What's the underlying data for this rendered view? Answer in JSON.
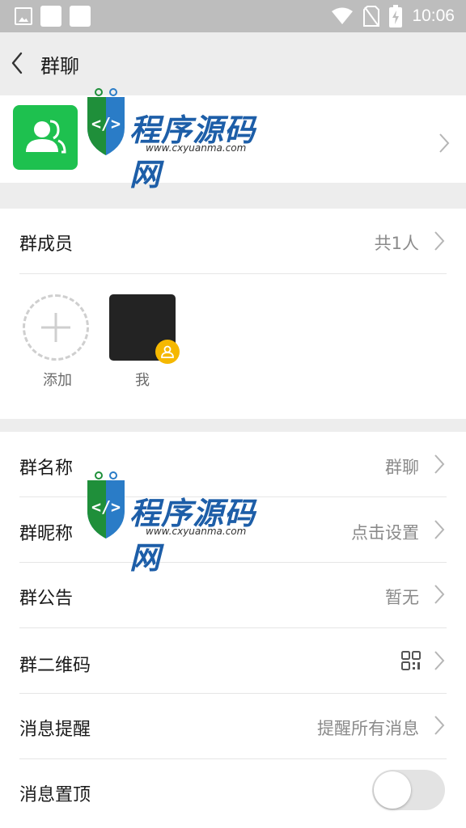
{
  "status_bar": {
    "time": "10:06"
  },
  "header": {
    "title": "群聊"
  },
  "members": {
    "label": "群成员",
    "count": "共1人",
    "add_label": "添加",
    "me_label": "我"
  },
  "settings": {
    "group_name": {
      "label": "群名称",
      "value": "群聊"
    },
    "nickname": {
      "label": "群昵称",
      "value": "点击设置"
    },
    "notice": {
      "label": "群公告",
      "value": "暂无"
    },
    "qrcode": {
      "label": "群二维码"
    },
    "reminder": {
      "label": "消息提醒",
      "value": "提醒所有消息"
    },
    "pin": {
      "label": "消息置顶",
      "enabled": false
    }
  },
  "watermark": {
    "text": "程序源码网",
    "url": "www.cxyuanma.com"
  },
  "colors": {
    "accent_green": "#1ec14f",
    "owner_badge": "#f5b800",
    "watermark_blue": "#1d5ea8"
  },
  "icons": [
    "image-icon",
    "wifi-icon",
    "no-sim-icon",
    "battery-icon",
    "back-icon",
    "group-icon",
    "chevron-right-icon",
    "plus-icon",
    "owner-icon",
    "qr-code-icon"
  ]
}
